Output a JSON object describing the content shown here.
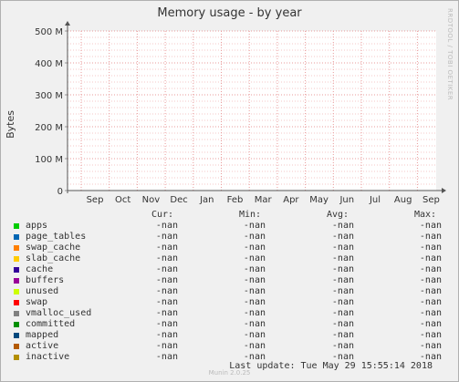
{
  "watermark": "RRDTOOL / TOBI OETIKER",
  "footer": {
    "last_update": "Last update: Tue May 29 15:55:14 2018",
    "version": "Munin 2.0.25"
  },
  "legend_headers": {
    "cur": "Cur:",
    "min": "Min:",
    "avg": "Avg:",
    "max": "Max:"
  },
  "legend": [
    {
      "name": "apps",
      "color": "#00cc00",
      "cur": "-nan",
      "min": "-nan",
      "avg": "-nan",
      "max": "-nan"
    },
    {
      "name": "page_tables",
      "color": "#0066b3",
      "cur": "-nan",
      "min": "-nan",
      "avg": "-nan",
      "max": "-nan"
    },
    {
      "name": "swap_cache",
      "color": "#ff8000",
      "cur": "-nan",
      "min": "-nan",
      "avg": "-nan",
      "max": "-nan"
    },
    {
      "name": "slab_cache",
      "color": "#ffcc00",
      "cur": "-nan",
      "min": "-nan",
      "avg": "-nan",
      "max": "-nan"
    },
    {
      "name": "cache",
      "color": "#330099",
      "cur": "-nan",
      "min": "-nan",
      "avg": "-nan",
      "max": "-nan"
    },
    {
      "name": "buffers",
      "color": "#990099",
      "cur": "-nan",
      "min": "-nan",
      "avg": "-nan",
      "max": "-nan"
    },
    {
      "name": "unused",
      "color": "#ccff00",
      "cur": "-nan",
      "min": "-nan",
      "avg": "-nan",
      "max": "-nan"
    },
    {
      "name": "swap",
      "color": "#ff0000",
      "cur": "-nan",
      "min": "-nan",
      "avg": "-nan",
      "max": "-nan"
    },
    {
      "name": "vmalloc_used",
      "color": "#808080",
      "cur": "-nan",
      "min": "-nan",
      "avg": "-nan",
      "max": "-nan"
    },
    {
      "name": "committed",
      "color": "#008f00",
      "cur": "-nan",
      "min": "-nan",
      "avg": "-nan",
      "max": "-nan"
    },
    {
      "name": "mapped",
      "color": "#00487d",
      "cur": "-nan",
      "min": "-nan",
      "avg": "-nan",
      "max": "-nan"
    },
    {
      "name": "active",
      "color": "#b35a00",
      "cur": "-nan",
      "min": "-nan",
      "avg": "-nan",
      "max": "-nan"
    },
    {
      "name": "inactive",
      "color": "#b38f00",
      "cur": "-nan",
      "min": "-nan",
      "avg": "-nan",
      "max": "-nan"
    }
  ],
  "chart_data": {
    "type": "area",
    "title": "Memory usage - by year",
    "ylabel": "Bytes",
    "xlabel": "",
    "y_ticks": [
      "0",
      "100 M",
      "200 M",
      "300 M",
      "400 M",
      "500 M"
    ],
    "y_tick_values": [
      0,
      100,
      200,
      300,
      400,
      500
    ],
    "ylim": [
      0,
      500
    ],
    "y_unit": "MB",
    "x_ticks": [
      "Sep",
      "Oct",
      "Nov",
      "Dec",
      "Jan",
      "Feb",
      "Mar",
      "Apr",
      "May",
      "Jun",
      "Jul",
      "Aug",
      "Sep"
    ],
    "grid": true,
    "series": []
  }
}
